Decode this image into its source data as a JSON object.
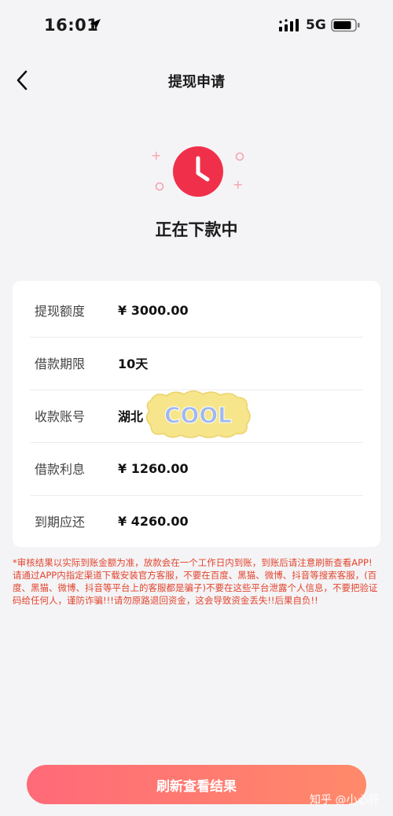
{
  "status_bar": {
    "time": "16:01",
    "network": "5G"
  },
  "header": {
    "title": "提现申请",
    "back_icon": "chevron-left-icon"
  },
  "status": {
    "icon": "clock-icon",
    "text": "正在下款中"
  },
  "details": {
    "rows": [
      {
        "label": "提现额度",
        "value": "¥ 3000.00"
      },
      {
        "label": "借款期限",
        "value": "10天"
      },
      {
        "label": "收款账号",
        "value": "湖北"
      },
      {
        "label": "借款利息",
        "value": "¥ 1260.00"
      },
      {
        "label": "到期应还",
        "value": "¥ 4260.00"
      }
    ],
    "sticker_text": "COOL"
  },
  "notice": {
    "text": "*审核结果以实际到账金额为准，放款会在一个工作日内到账，到账后请注意刷新查看APP!请通过APP内指定渠道下载安装官方客服，不要在百度、黑猫、微博、抖音等搜索客服，(百度、黑猫、微博、抖音等平台上的客服都是骗子)不要在这些平台泄露个人信息，不要把验证码给任何人，谨防诈骗!!!请勿原路退回资金，这会导致资金丢失!!后果自负!!"
  },
  "actions": {
    "refresh_label": "刷新查看结果"
  },
  "watermark": {
    "text": "知乎 @小心肝"
  },
  "colors": {
    "accent": "#f0304a",
    "notice": "#e2452f",
    "button_start": "#ff6a78",
    "button_end": "#ff8a6a",
    "background": "#f4f4f6"
  }
}
